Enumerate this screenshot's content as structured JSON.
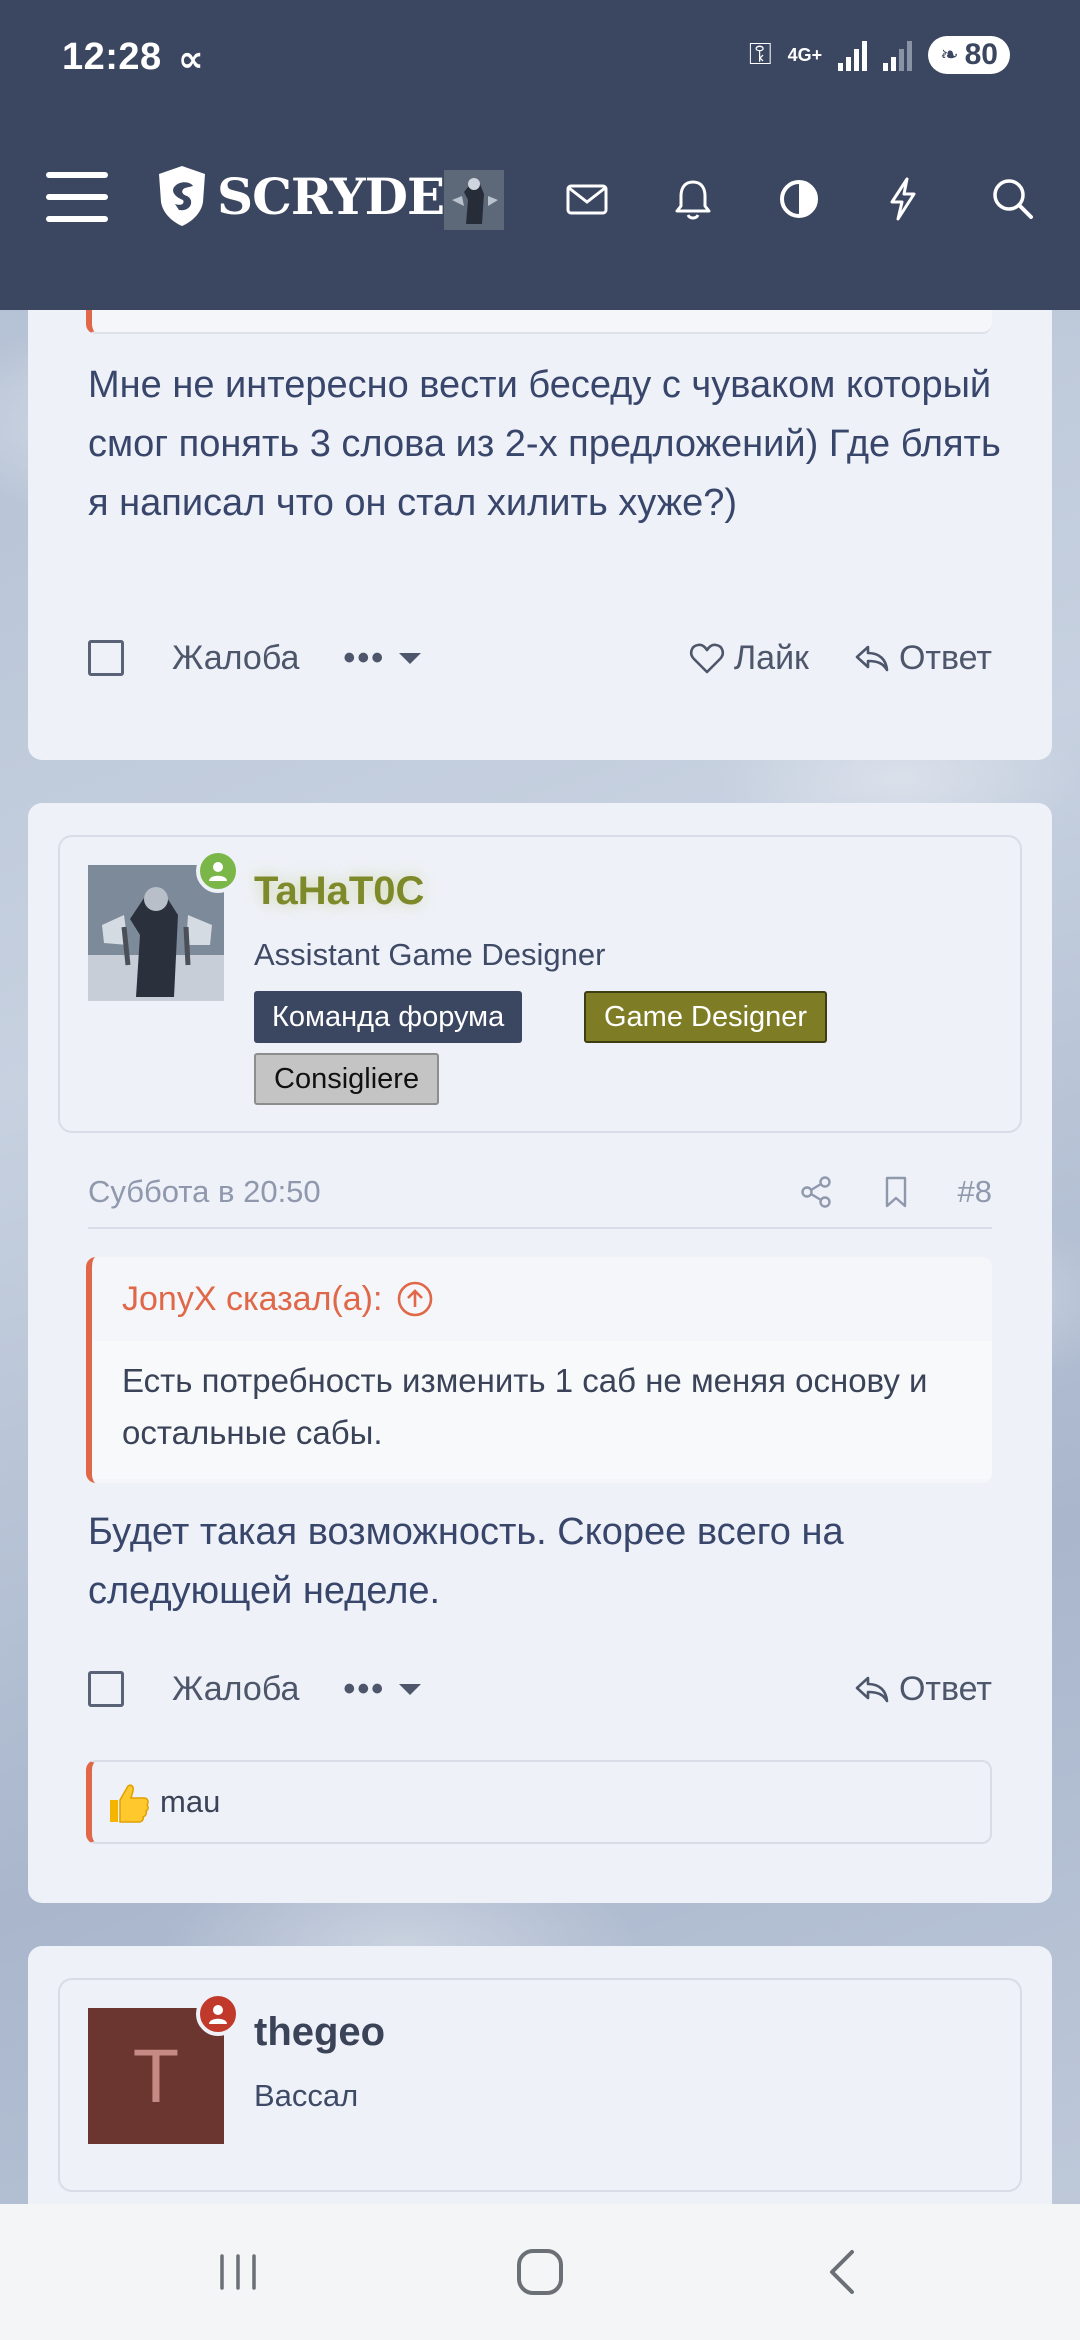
{
  "status": {
    "time": "12:28",
    "net": "4G+",
    "battery": "80"
  },
  "header": {
    "logo_text": "SCRYDE",
    "icons": [
      "menu-icon",
      "mail-icon",
      "bell-icon",
      "contrast-icon",
      "bolt-icon",
      "search-icon"
    ]
  },
  "post1": {
    "quote_partial": "",
    "text": "Мне не интересно вести беседу с чуваком который смог понять 3 слова из 2-х предложений) Где блять я написал что он стал хилить хуже?)",
    "report": "Жалоба",
    "more": "•••",
    "like": "Лайк",
    "reply": "Ответ"
  },
  "post2": {
    "user": {
      "name": "TaHaT0C",
      "title": "Assistant Game Designer",
      "badges": [
        "Команда форума",
        "Game Designer",
        "Consigliere"
      ],
      "name_color": "#7e8a2a"
    },
    "date": "Суббота в 20:50",
    "number": "#8",
    "quote": {
      "author": "JonyX сказал(а):",
      "text": "Есть потребность изменить 1 саб не меняя основу и остальные сабы."
    },
    "text": "Будет такая возможность. Скорее всего на следующей неделе.",
    "report": "Жалоба",
    "more": "•••",
    "reply": "Ответ",
    "reaction_user": "mau"
  },
  "post3": {
    "user": {
      "name": "thegeo",
      "title": "Вассал",
      "initial": "T",
      "avatar_bg": "#6b3530"
    }
  },
  "colors": {
    "header_bg": "#3b4660",
    "accent": "#e06848",
    "online_green": "#7ab648",
    "offline_red": "#c0392b"
  }
}
